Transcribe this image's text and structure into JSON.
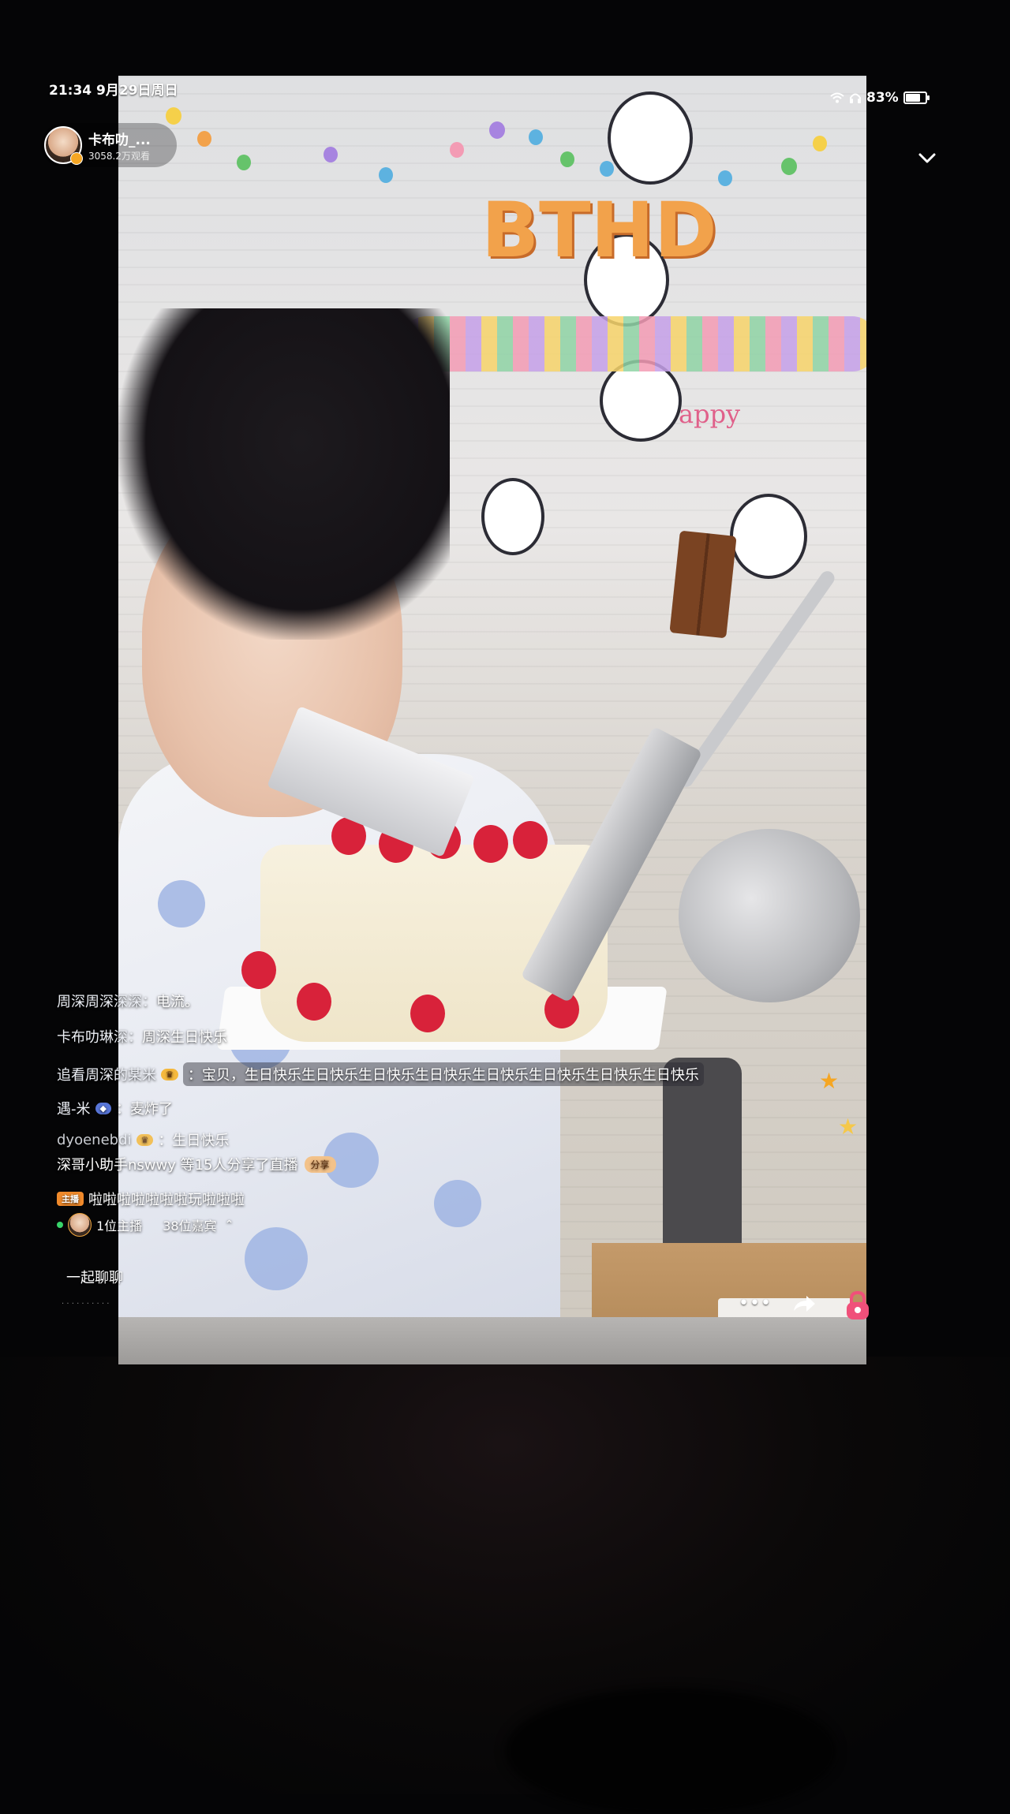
{
  "status_bar": {
    "time_date": "21:34  9月29日周日",
    "battery": "83%",
    "battery_level": 0.83,
    "icons": [
      "wifi-icon",
      "headphones-icon",
      "battery-icon"
    ]
  },
  "anchor": {
    "name": "卡布叻_...",
    "views": "3058.2万观看"
  },
  "video_scene": {
    "banner_text": "BTHD",
    "sign_text": "appy"
  },
  "chat": {
    "messages": [
      {
        "user": "周深周深深深：",
        "badge": "",
        "text": "电流。"
      },
      {
        "user": "卡布叻琳深：",
        "badge": "",
        "text": "周深生日快乐"
      },
      {
        "user": "追看周深的某米",
        "badge": "",
        "text": "：宝贝，生日快乐生日快乐生日快乐生日快乐生日快乐生日快乐生日快乐生日快乐"
      },
      {
        "user": "遇-米",
        "badge": "",
        "text": "：麦炸了"
      },
      {
        "user": "dyoenebdi",
        "badge": "",
        "text": "：生日快乐"
      }
    ],
    "share_notice": {
      "text": "深哥小助手nswwy 等15人分享了直播",
      "chip": "分享"
    },
    "host_message": {
      "tag": "主播",
      "text": "啦啦啦啦啦啦啦玩啦啦啦"
    },
    "online": {
      "hosts": "1位主播",
      "guests": "38位嘉宾"
    }
  },
  "bottom": {
    "chat_together": "一起聊聊"
  },
  "colors": {
    "accent_orange": "#f08a2b",
    "online_green": "#38d46a",
    "lock_pink": "#f0507a"
  }
}
